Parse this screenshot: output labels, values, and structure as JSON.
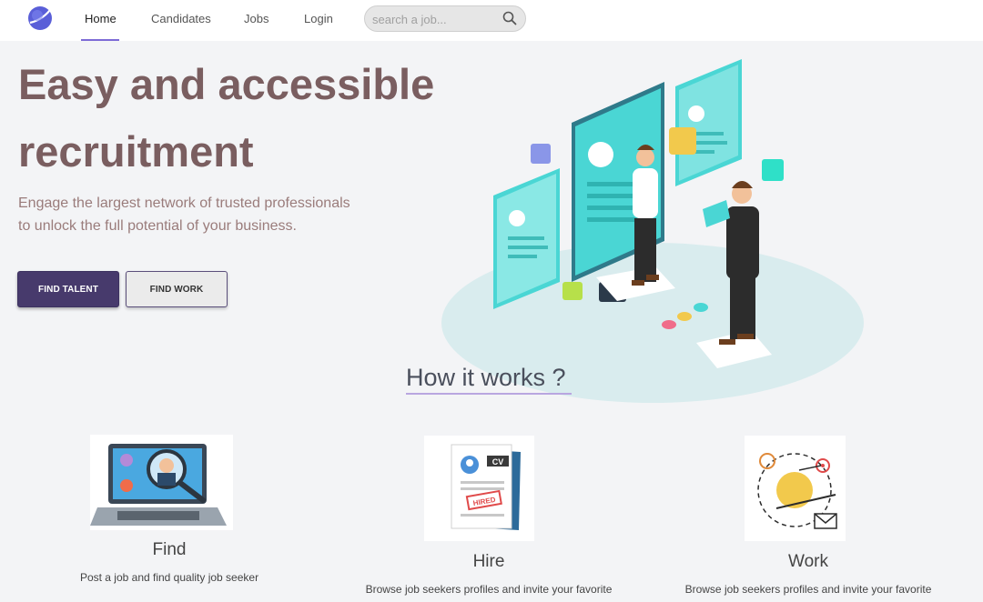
{
  "nav": {
    "items": [
      {
        "label": "Home",
        "active": true
      },
      {
        "label": "Candidates"
      },
      {
        "label": "Jobs"
      },
      {
        "label": "Login"
      }
    ],
    "search_placeholder": "search a job...",
    "logo_icon": "planet-logo-icon",
    "search_icon": "search-icon"
  },
  "hero": {
    "title_line1": "Easy and accessible",
    "title_line2": "recruitment",
    "subtitle_line1": "Engage the largest network of trusted professionals",
    "subtitle_line2": "to unlock the full potential of your business.",
    "find_talent": "FIND TALENT",
    "find_work": "FIND WORK"
  },
  "illustration": {
    "cv_badge": "CV",
    "hired_stamp": "HIRED"
  },
  "how_it_works": {
    "title": "How it works ?",
    "steps": [
      {
        "title": "Find",
        "description": "Post a job and find quality job seeker",
        "icon": "laptop-search-icon"
      },
      {
        "title": "Hire",
        "description": "Browse job seekers profiles and invite your favorite",
        "icon": "cv-hired-icon"
      },
      {
        "title": "Work",
        "description": "Browse job seekers profiles and invite your favorite",
        "icon": "target-work-icon"
      }
    ]
  },
  "colors": {
    "primary": "#473a6c",
    "hero_title": "#7a5e60",
    "hero_sub": "#9a7c7b",
    "accent": "#7d6bd6",
    "teal": "#4ad6d4"
  }
}
